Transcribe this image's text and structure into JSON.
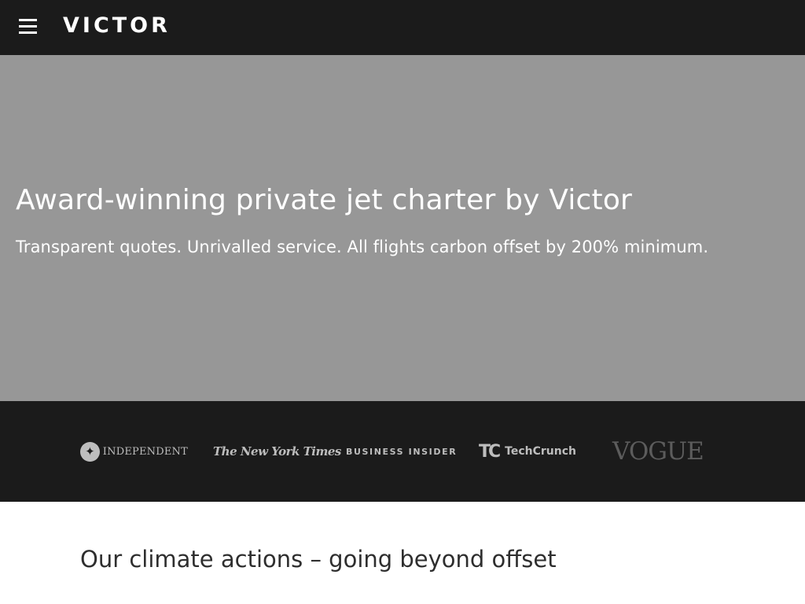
{
  "header": {
    "menu_icon": "hamburger-menu-icon",
    "brand": "VICTOR"
  },
  "hero": {
    "title": "Award-winning private jet charter by Victor",
    "subtitle": "Transparent quotes. Unrivalled service. All flights carbon offset by 200% minimum."
  },
  "press": {
    "logos": [
      {
        "name": "INDEPENDENT",
        "icon": "eagle-icon"
      },
      {
        "name": "The New York Times"
      },
      {
        "name": "BUSINESS INSIDER"
      },
      {
        "name": "TechCrunch",
        "mark": "TC"
      },
      {
        "name": "VOGUE"
      }
    ]
  },
  "section": {
    "title": "Our climate actions – going beyond offset"
  },
  "colors": {
    "header_bg": "#1b1b1b",
    "hero_bg": "#979797",
    "press_bg": "#1b1b1b",
    "text_light": "#ffffff",
    "logo_grey": "#bdbdbd",
    "heading_dark": "#2e2e2e"
  }
}
